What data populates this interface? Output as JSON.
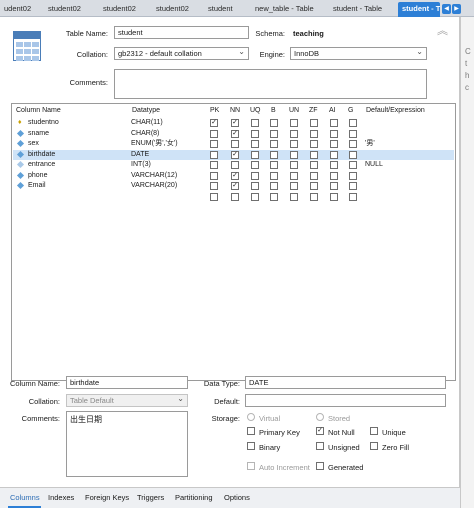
{
  "tabs": [
    {
      "label": "udent02"
    },
    {
      "label": "student02"
    },
    {
      "label": "student02"
    },
    {
      "label": "student02"
    },
    {
      "label": "student"
    },
    {
      "label": "new_table - Table"
    },
    {
      "label": "student - Table"
    },
    {
      "label": "student - Table",
      "active": true,
      "close": "×"
    }
  ],
  "tab_nav": {
    "left": "◀",
    "right": "▶"
  },
  "right_pane_glyphs": [
    "C",
    "t",
    "h",
    "c"
  ],
  "header": {
    "table_name_label": "Table Name:",
    "table_name_value": "student",
    "schema_label": "Schema:",
    "schema_value": "teaching",
    "collation_label": "Collation:",
    "collation_value": "gb2312 - default collation",
    "engine_label": "Engine:",
    "engine_value": "InnoDB",
    "comments_label": "Comments:",
    "comments_value": "",
    "collapse_glyph": "︽"
  },
  "grid": {
    "columns": [
      "Column Name",
      "Datatype",
      "PK",
      "NN",
      "UQ",
      "B",
      "UN",
      "ZF",
      "AI",
      "G",
      "Default/Expression"
    ],
    "rows": [
      {
        "icon": "key-icon",
        "name": "studentno",
        "type": "CHAR(11)",
        "flags": [
          true,
          true,
          false,
          false,
          false,
          false,
          false,
          false
        ],
        "default": "",
        "selected": false
      },
      {
        "icon": "diamond-icon",
        "name": "sname",
        "type": "CHAR(8)",
        "flags": [
          false,
          true,
          false,
          false,
          false,
          false,
          false,
          false
        ],
        "default": "",
        "selected": false
      },
      {
        "icon": "diamond-icon",
        "name": "sex",
        "type": "ENUM('男','女')",
        "flags": [
          false,
          false,
          false,
          false,
          false,
          false,
          false,
          false
        ],
        "default": "'男'",
        "selected": false
      },
      {
        "icon": "diamond-icon",
        "name": "birthdate",
        "type": "DATE",
        "flags": [
          false,
          true,
          false,
          false,
          false,
          false,
          false,
          false
        ],
        "default": "",
        "selected": true
      },
      {
        "icon": "diamond-light-icon",
        "name": "entrance",
        "type": "INT(3)",
        "flags": [
          false,
          false,
          false,
          false,
          false,
          false,
          false,
          false
        ],
        "default": "NULL",
        "selected": false
      },
      {
        "icon": "diamond-icon",
        "name": "phone",
        "type": "VARCHAR(12)",
        "flags": [
          false,
          true,
          false,
          false,
          false,
          false,
          false,
          false
        ],
        "default": "",
        "selected": false
      },
      {
        "icon": "diamond-icon",
        "name": "Email",
        "type": "VARCHAR(20)",
        "flags": [
          false,
          true,
          false,
          false,
          false,
          false,
          false,
          false
        ],
        "default": "",
        "selected": false
      },
      {
        "icon": "",
        "name": "",
        "type": "",
        "flags": [
          false,
          false,
          false,
          false,
          false,
          false,
          false,
          false
        ],
        "default": "",
        "selected": false
      }
    ]
  },
  "detail": {
    "column_name_label": "Column Name:",
    "column_name_value": "birthdate",
    "data_type_label": "Data Type:",
    "data_type_value": "DATE",
    "collation_label": "Collation:",
    "collation_value": "Table Default",
    "default_label": "Default:",
    "default_value": "",
    "comments_label": "Comments:",
    "comments_value": "出生日期",
    "storage_label": "Storage:",
    "storage_virtual": "Virtual",
    "storage_stored": "Stored",
    "primary_key": "Primary Key",
    "not_null": "Not Null",
    "unique": "Unique",
    "binary": "Binary",
    "unsigned": "Unsigned",
    "zero_fill": "Zero Fill",
    "auto_increment": "Auto Increment",
    "generated": "Generated",
    "checked_glyph": "✓",
    "not_null_checked": true
  },
  "bottom_tabs": [
    "Columns",
    "Indexes",
    "Foreign Keys",
    "Triggers",
    "Partitioning",
    "Options"
  ]
}
